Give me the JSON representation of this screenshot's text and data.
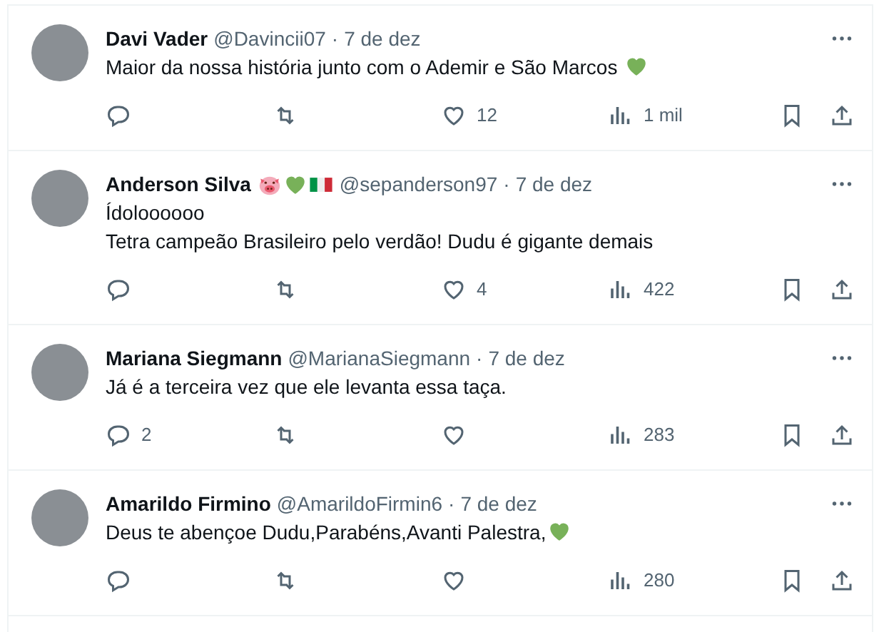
{
  "tweets": [
    {
      "name": "Davi Vader",
      "handle": "@Davincii07",
      "separator": "·",
      "date": "7 de dez",
      "lines": [
        [
          {
            "kind": "text",
            "text": "Maior da nossa história junto com o Ademir e São Marcos "
          },
          {
            "kind": "heart"
          }
        ]
      ],
      "likes": "12",
      "views": "1 mil"
    },
    {
      "name": "Anderson Silva",
      "name_extras": [
        {
          "kind": "pig"
        },
        {
          "kind": "heart"
        },
        {
          "kind": "flag"
        }
      ],
      "handle": "@sepanderson97",
      "separator": "·",
      "date": "7 de dez",
      "lines": [
        [
          {
            "kind": "text",
            "text": "Ídoloooooo"
          }
        ],
        [
          {
            "kind": "text",
            "text": "Tetra campeão Brasileiro pelo verdão! Dudu é gigante demais"
          }
        ]
      ],
      "likes": "4",
      "views": "422"
    },
    {
      "name": "Mariana Siegmann",
      "handle": "@MarianaSiegmann",
      "separator": "·",
      "date": "7 de dez",
      "lines": [
        [
          {
            "kind": "text",
            "text": "Já é a terceira vez que ele levanta essa taça."
          }
        ]
      ],
      "replies": "2",
      "views": "283"
    },
    {
      "name": "Amarildo Firmino",
      "handle": "@AmarildoFirmin6",
      "separator": "·",
      "date": "7 de dez",
      "lines": [
        [
          {
            "kind": "text",
            "text": "Deus te abençoe Dudu,Parabéns,Avanti Palestra,"
          },
          {
            "kind": "heart"
          }
        ]
      ],
      "views": "280"
    }
  ]
}
